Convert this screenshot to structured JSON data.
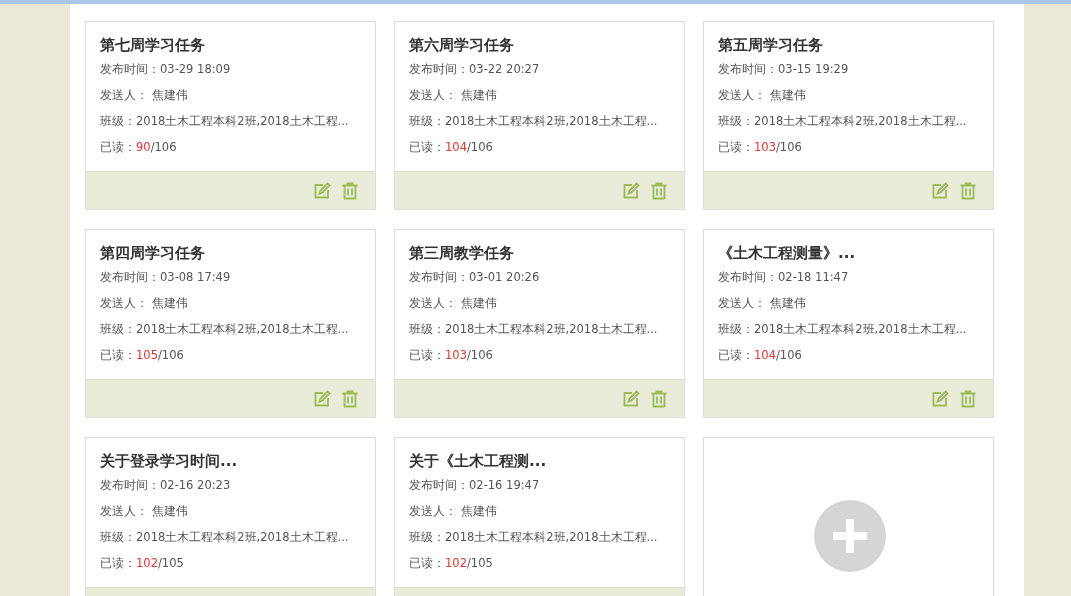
{
  "cards": [
    {
      "kind": "notice",
      "title": "第七周学习任务",
      "time_label": "发布时间：",
      "time": "03-29 18:09",
      "sender_label": "发送人：",
      "sender": "焦建伟",
      "class_label": "班级：",
      "classes": "2018土木工程本科2班,2018土木工程...",
      "read_label": "已读：",
      "read": "90",
      "total": "/106"
    },
    {
      "kind": "notice",
      "title": "第六周学习任务",
      "time_label": "发布时间：",
      "time": "03-22 20:27",
      "sender_label": "发送人：",
      "sender": "焦建伟",
      "class_label": "班级：",
      "classes": "2018土木工程本科2班,2018土木工程...",
      "read_label": "已读：",
      "read": "104",
      "total": "/106"
    },
    {
      "kind": "notice",
      "title": "第五周学习任务",
      "time_label": "发布时间：",
      "time": "03-15 19:29",
      "sender_label": "发送人：",
      "sender": "焦建伟",
      "class_label": "班级：",
      "classes": "2018土木工程本科2班,2018土木工程...",
      "read_label": "已读：",
      "read": "103",
      "total": "/106"
    },
    {
      "kind": "notice",
      "title": "第四周学习任务",
      "time_label": "发布时间：",
      "time": "03-08 17:49",
      "sender_label": "发送人：",
      "sender": "焦建伟",
      "class_label": "班级：",
      "classes": "2018土木工程本科2班,2018土木工程...",
      "read_label": "已读：",
      "read": "105",
      "total": "/106"
    },
    {
      "kind": "notice",
      "title": "第三周教学任务",
      "time_label": "发布时间：",
      "time": "03-01 20:26",
      "sender_label": "发送人：",
      "sender": "焦建伟",
      "class_label": "班级：",
      "classes": "2018土木工程本科2班,2018土木工程...",
      "read_label": "已读：",
      "read": "103",
      "total": "/106"
    },
    {
      "kind": "notice",
      "title": "《土木工程测量》...",
      "time_label": "发布时间：",
      "time": "02-18 11:47",
      "sender_label": "发送人：",
      "sender": "焦建伟",
      "class_label": "班级：",
      "classes": "2018土木工程本科2班,2018土木工程...",
      "read_label": "已读：",
      "read": "104",
      "total": "/106"
    },
    {
      "kind": "notice",
      "title": "关于登录学习时间...",
      "time_label": "发布时间：",
      "time": "02-16 20:23",
      "sender_label": "发送人：",
      "sender": "焦建伟",
      "class_label": "班级：",
      "classes": "2018土木工程本科2班,2018土木工程...",
      "read_label": "已读：",
      "read": "102",
      "total": "/105"
    },
    {
      "kind": "notice",
      "title": "关于《土木工程测...",
      "time_label": "发布时间：",
      "time": "02-16 19:47",
      "sender_label": "发送人：",
      "sender": "焦建伟",
      "class_label": "班级：",
      "classes": "2018土木工程本科2班,2018土木工程...",
      "read_label": "已读：",
      "read": "102",
      "total": "/105"
    },
    {
      "kind": "add"
    }
  ]
}
